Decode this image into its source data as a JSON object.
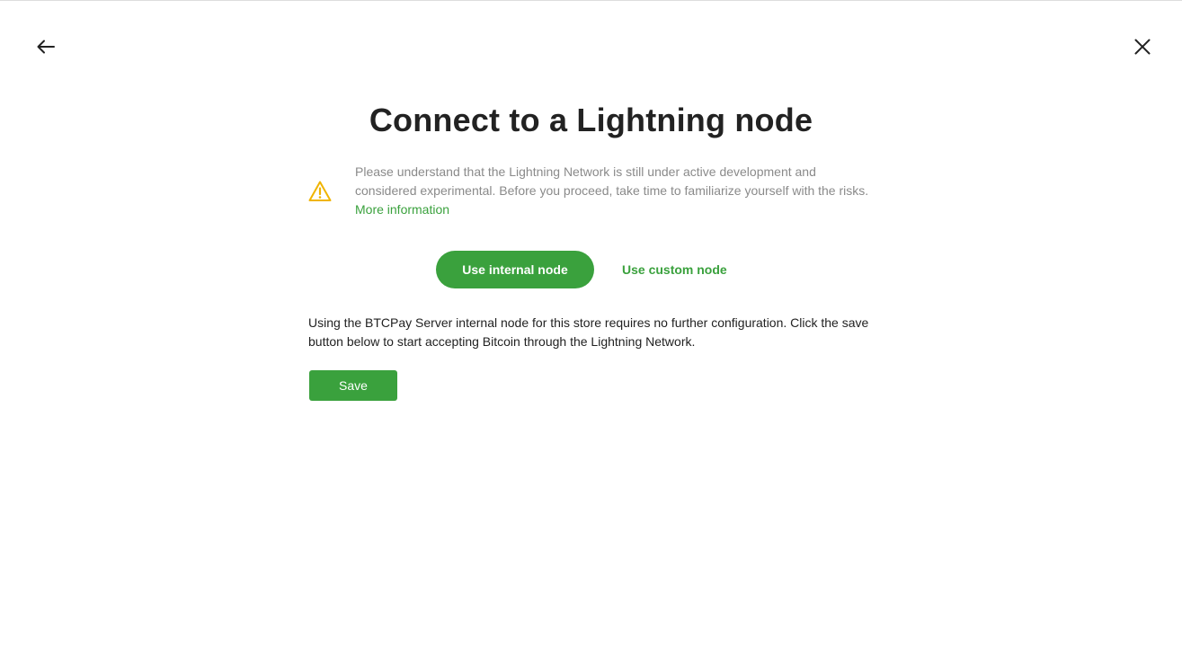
{
  "page": {
    "title": "Connect to a Lightning node"
  },
  "nav": {
    "back_icon": "arrow-left-icon",
    "close_icon": "close-icon"
  },
  "warning": {
    "icon": "warning-triangle-icon",
    "text": "Please understand that the Lightning Network is still under active development and considered experimental. Before you proceed, take time to familiarize yourself with the risks.",
    "link_label": "More information"
  },
  "node_options": {
    "internal_label": "Use internal node",
    "custom_label": "Use custom node",
    "selected": "internal"
  },
  "description": "Using the BTCPay Server internal node for this store requires no further configuration. Click the save button below to start accepting Bitcoin through the Lightning Network.",
  "actions": {
    "save_label": "Save"
  },
  "colors": {
    "accent": "#3aa13d",
    "warning": "#f0b400",
    "muted_text": "#8a8a8a"
  }
}
